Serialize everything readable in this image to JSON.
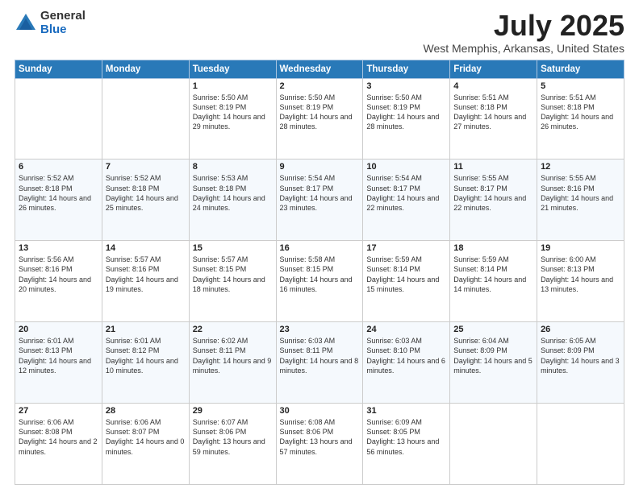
{
  "logo": {
    "general": "General",
    "blue": "Blue"
  },
  "header": {
    "month": "July 2025",
    "location": "West Memphis, Arkansas, United States"
  },
  "days_of_week": [
    "Sunday",
    "Monday",
    "Tuesday",
    "Wednesday",
    "Thursday",
    "Friday",
    "Saturday"
  ],
  "weeks": [
    [
      {
        "day": "",
        "info": ""
      },
      {
        "day": "",
        "info": ""
      },
      {
        "day": "1",
        "info": "Sunrise: 5:50 AM\nSunset: 8:19 PM\nDaylight: 14 hours and 29 minutes."
      },
      {
        "day": "2",
        "info": "Sunrise: 5:50 AM\nSunset: 8:19 PM\nDaylight: 14 hours and 28 minutes."
      },
      {
        "day": "3",
        "info": "Sunrise: 5:50 AM\nSunset: 8:19 PM\nDaylight: 14 hours and 28 minutes."
      },
      {
        "day": "4",
        "info": "Sunrise: 5:51 AM\nSunset: 8:18 PM\nDaylight: 14 hours and 27 minutes."
      },
      {
        "day": "5",
        "info": "Sunrise: 5:51 AM\nSunset: 8:18 PM\nDaylight: 14 hours and 26 minutes."
      }
    ],
    [
      {
        "day": "6",
        "info": "Sunrise: 5:52 AM\nSunset: 8:18 PM\nDaylight: 14 hours and 26 minutes."
      },
      {
        "day": "7",
        "info": "Sunrise: 5:52 AM\nSunset: 8:18 PM\nDaylight: 14 hours and 25 minutes."
      },
      {
        "day": "8",
        "info": "Sunrise: 5:53 AM\nSunset: 8:18 PM\nDaylight: 14 hours and 24 minutes."
      },
      {
        "day": "9",
        "info": "Sunrise: 5:54 AM\nSunset: 8:17 PM\nDaylight: 14 hours and 23 minutes."
      },
      {
        "day": "10",
        "info": "Sunrise: 5:54 AM\nSunset: 8:17 PM\nDaylight: 14 hours and 22 minutes."
      },
      {
        "day": "11",
        "info": "Sunrise: 5:55 AM\nSunset: 8:17 PM\nDaylight: 14 hours and 22 minutes."
      },
      {
        "day": "12",
        "info": "Sunrise: 5:55 AM\nSunset: 8:16 PM\nDaylight: 14 hours and 21 minutes."
      }
    ],
    [
      {
        "day": "13",
        "info": "Sunrise: 5:56 AM\nSunset: 8:16 PM\nDaylight: 14 hours and 20 minutes."
      },
      {
        "day": "14",
        "info": "Sunrise: 5:57 AM\nSunset: 8:16 PM\nDaylight: 14 hours and 19 minutes."
      },
      {
        "day": "15",
        "info": "Sunrise: 5:57 AM\nSunset: 8:15 PM\nDaylight: 14 hours and 18 minutes."
      },
      {
        "day": "16",
        "info": "Sunrise: 5:58 AM\nSunset: 8:15 PM\nDaylight: 14 hours and 16 minutes."
      },
      {
        "day": "17",
        "info": "Sunrise: 5:59 AM\nSunset: 8:14 PM\nDaylight: 14 hours and 15 minutes."
      },
      {
        "day": "18",
        "info": "Sunrise: 5:59 AM\nSunset: 8:14 PM\nDaylight: 14 hours and 14 minutes."
      },
      {
        "day": "19",
        "info": "Sunrise: 6:00 AM\nSunset: 8:13 PM\nDaylight: 14 hours and 13 minutes."
      }
    ],
    [
      {
        "day": "20",
        "info": "Sunrise: 6:01 AM\nSunset: 8:13 PM\nDaylight: 14 hours and 12 minutes."
      },
      {
        "day": "21",
        "info": "Sunrise: 6:01 AM\nSunset: 8:12 PM\nDaylight: 14 hours and 10 minutes."
      },
      {
        "day": "22",
        "info": "Sunrise: 6:02 AM\nSunset: 8:11 PM\nDaylight: 14 hours and 9 minutes."
      },
      {
        "day": "23",
        "info": "Sunrise: 6:03 AM\nSunset: 8:11 PM\nDaylight: 14 hours and 8 minutes."
      },
      {
        "day": "24",
        "info": "Sunrise: 6:03 AM\nSunset: 8:10 PM\nDaylight: 14 hours and 6 minutes."
      },
      {
        "day": "25",
        "info": "Sunrise: 6:04 AM\nSunset: 8:09 PM\nDaylight: 14 hours and 5 minutes."
      },
      {
        "day": "26",
        "info": "Sunrise: 6:05 AM\nSunset: 8:09 PM\nDaylight: 14 hours and 3 minutes."
      }
    ],
    [
      {
        "day": "27",
        "info": "Sunrise: 6:06 AM\nSunset: 8:08 PM\nDaylight: 14 hours and 2 minutes."
      },
      {
        "day": "28",
        "info": "Sunrise: 6:06 AM\nSunset: 8:07 PM\nDaylight: 14 hours and 0 minutes."
      },
      {
        "day": "29",
        "info": "Sunrise: 6:07 AM\nSunset: 8:06 PM\nDaylight: 13 hours and 59 minutes."
      },
      {
        "day": "30",
        "info": "Sunrise: 6:08 AM\nSunset: 8:06 PM\nDaylight: 13 hours and 57 minutes."
      },
      {
        "day": "31",
        "info": "Sunrise: 6:09 AM\nSunset: 8:05 PM\nDaylight: 13 hours and 56 minutes."
      },
      {
        "day": "",
        "info": ""
      },
      {
        "day": "",
        "info": ""
      }
    ]
  ]
}
